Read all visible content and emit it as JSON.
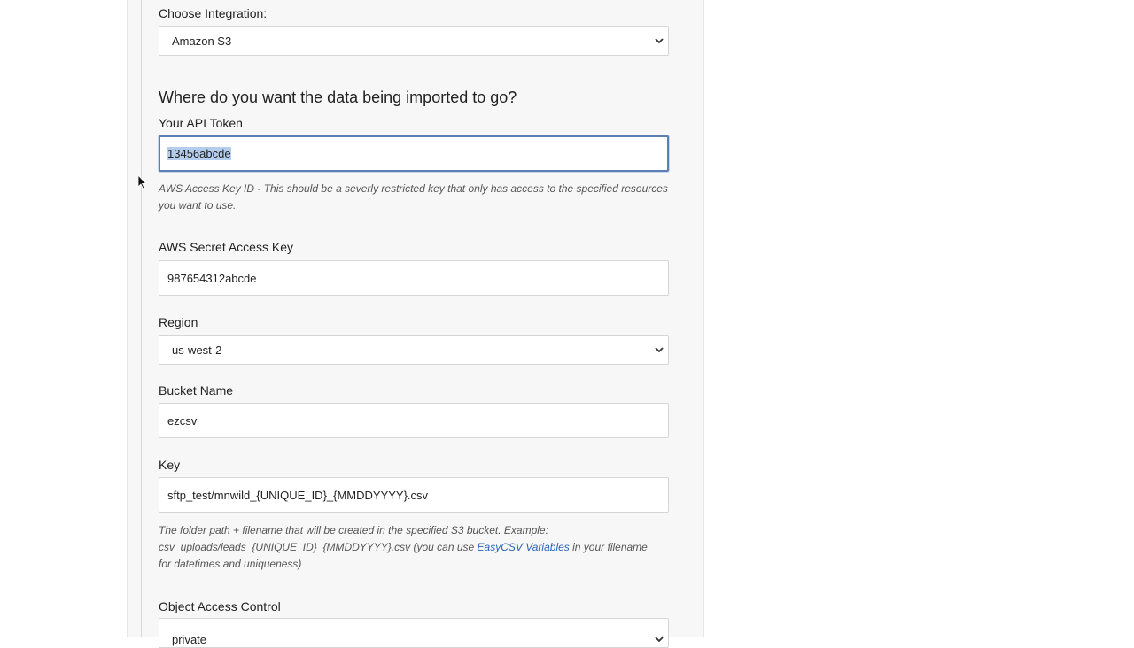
{
  "integration": {
    "label": "Choose Integration:",
    "selected": "Amazon S3"
  },
  "destination_heading": "Where do you want the data being imported to go?",
  "api_token": {
    "label": "Your API Token",
    "value": "13456abcde",
    "help": "AWS Access Key ID - This should be a severly restricted key that only has access to the specified resources you want to use."
  },
  "secret_key": {
    "label": "AWS Secret Access Key",
    "value": "987654312abcde"
  },
  "region": {
    "label": "Region",
    "selected": "us-west-2"
  },
  "bucket": {
    "label": "Bucket Name",
    "value": "ezcsv"
  },
  "key": {
    "label": "Key",
    "value": "sftp_test/mnwild_{UNIQUE_ID}_{MMDDYYYY}.csv",
    "help_before": "The folder path + filename that will be created in the specified S3 bucket. Example: csv_uploads/leads_{UNIQUE_ID}_{MMDDYYYY}.csv (you can use ",
    "help_link": "EasyCSV Variables",
    "help_after": " in your filename for datetimes and uniqueness)"
  },
  "acl": {
    "label": "Object Access Control",
    "selected": "private"
  },
  "icons": {
    "select_arrow": "chevron-down-icon",
    "pointer": "mouse-pointer-icon"
  },
  "colors": {
    "focus_border": "#5b7fb5",
    "selection_highlight": "#b4cdec",
    "link": "#2a64b7"
  }
}
